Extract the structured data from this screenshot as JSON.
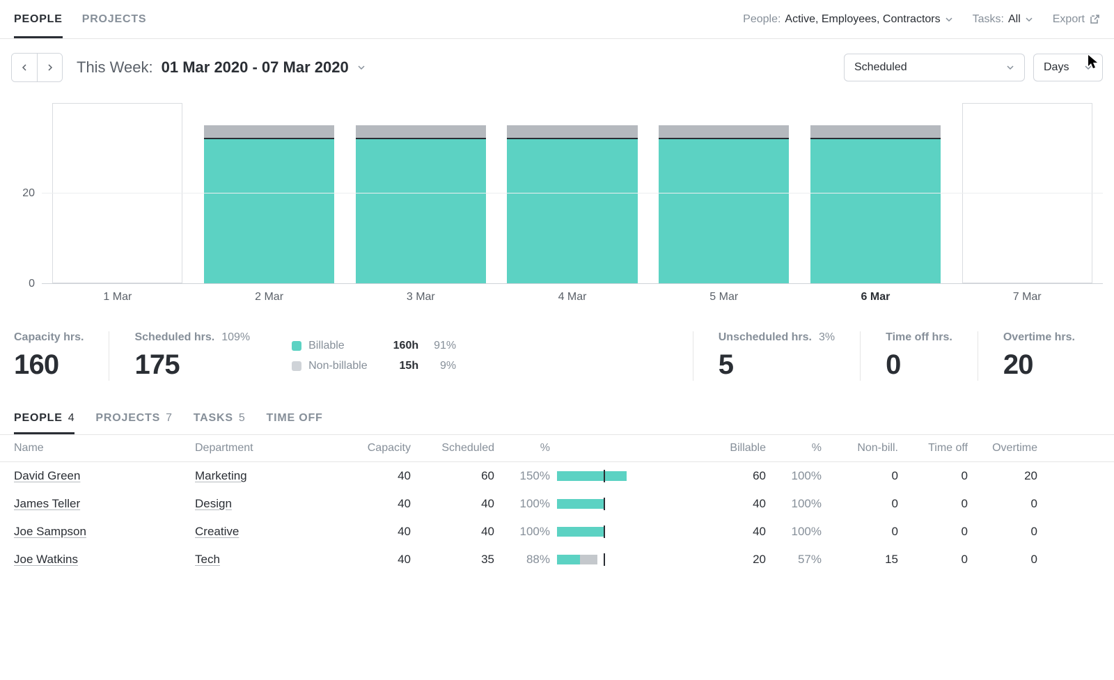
{
  "topTabs": {
    "people": "PEOPLE",
    "projects": "PROJECTS"
  },
  "filters": {
    "people_label": "People:",
    "people_value": "Active, Employees, Contractors",
    "tasks_label": "Tasks:",
    "tasks_value": "All",
    "export": "Export"
  },
  "week": {
    "prefix": "This Week:",
    "range": "01 Mar 2020  -  07 Mar 2020"
  },
  "selectors": {
    "metric": "Scheduled",
    "grouping": "Days"
  },
  "chart_data": {
    "type": "bar",
    "ylim": [
      0,
      40
    ],
    "yticks": [
      0,
      20
    ],
    "today_index": 5,
    "categories": [
      "1 Mar",
      "2 Mar",
      "3 Mar",
      "4 Mar",
      "5 Mar",
      "6 Mar",
      "7 Mar"
    ],
    "series": [
      {
        "name": "Billable",
        "color": "#5cd2c3",
        "values": [
          0,
          32,
          32,
          32,
          32,
          32,
          0
        ]
      },
      {
        "name": "Non-billable",
        "color": "#b5b9be",
        "values": [
          0,
          3,
          3,
          3,
          3,
          3,
          0
        ]
      }
    ]
  },
  "summary": {
    "capacity": {
      "label": "Capacity hrs.",
      "value": "160"
    },
    "scheduled": {
      "label": "Scheduled hrs.",
      "pct": "109%",
      "value": "175"
    },
    "billable": {
      "name": "Billable",
      "hours": "160h",
      "pct": "91%",
      "color": "#5cd2c3"
    },
    "nonbillable": {
      "name": "Non-billable",
      "hours": "15h",
      "pct": "9%",
      "color": "#cfd3d8"
    },
    "unscheduled": {
      "label": "Unscheduled hrs.",
      "pct": "3%",
      "value": "5"
    },
    "timeoff": {
      "label": "Time off hrs.",
      "value": "0"
    },
    "overtime": {
      "label": "Overtime hrs.",
      "value": "20"
    }
  },
  "subTabs": {
    "people": {
      "label": "PEOPLE",
      "count": "4"
    },
    "projects": {
      "label": "PROJECTS",
      "count": "7"
    },
    "tasks": {
      "label": "TASKS",
      "count": "5"
    },
    "timeoff": {
      "label": "TIME OFF"
    }
  },
  "table": {
    "columns": {
      "name": "Name",
      "department": "Department",
      "capacity": "Capacity",
      "scheduled": "Scheduled",
      "sched_pct": "%",
      "billable": "Billable",
      "bill_pct": "%",
      "nonbill": "Non-bill.",
      "timeoff": "Time off",
      "overtime": "Overtime"
    },
    "rows": [
      {
        "name": "David Green",
        "department": "Marketing",
        "capacity": "40",
        "scheduled": "60",
        "sched_pct": "150%",
        "bar_bill": 60,
        "bar_nonbill": 0,
        "bar_cap": 40,
        "billable": "60",
        "bill_pct": "100%",
        "nonbill": "0",
        "timeoff": "0",
        "overtime": "20"
      },
      {
        "name": "James Teller",
        "department": "Design",
        "capacity": "40",
        "scheduled": "40",
        "sched_pct": "100%",
        "bar_bill": 40,
        "bar_nonbill": 0,
        "bar_cap": 40,
        "billable": "40",
        "bill_pct": "100%",
        "nonbill": "0",
        "timeoff": "0",
        "overtime": "0"
      },
      {
        "name": "Joe Sampson",
        "department": "Creative",
        "capacity": "40",
        "scheduled": "40",
        "sched_pct": "100%",
        "bar_bill": 40,
        "bar_nonbill": 0,
        "bar_cap": 40,
        "billable": "40",
        "bill_pct": "100%",
        "nonbill": "0",
        "timeoff": "0",
        "overtime": "0"
      },
      {
        "name": "Joe Watkins",
        "department": "Tech",
        "capacity": "40",
        "scheduled": "35",
        "sched_pct": "88%",
        "bar_bill": 20,
        "bar_nonbill": 15,
        "bar_cap": 40,
        "billable": "20",
        "bill_pct": "57%",
        "nonbill": "15",
        "timeoff": "0",
        "overtime": "0"
      }
    ]
  }
}
